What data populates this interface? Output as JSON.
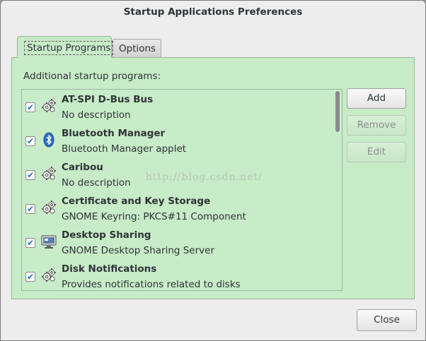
{
  "window": {
    "title": "Startup Applications Preferences"
  },
  "tabs": [
    {
      "label": "Startup Programs",
      "active": true
    },
    {
      "label": "Options",
      "active": false
    }
  ],
  "panel": {
    "label": "Additional startup programs:"
  },
  "programs": [
    {
      "name": "AT-SPI D-Bus Bus",
      "description": "No description",
      "checked": true,
      "icon": "gears-icon"
    },
    {
      "name": "Bluetooth Manager",
      "description": "Bluetooth Manager applet",
      "checked": true,
      "icon": "bluetooth-icon"
    },
    {
      "name": "Caribou",
      "description": "No description",
      "checked": true,
      "icon": "gears-icon"
    },
    {
      "name": "Certificate and Key Storage",
      "description": "GNOME Keyring: PKCS#11 Component",
      "checked": true,
      "icon": "gears-icon"
    },
    {
      "name": "Desktop Sharing",
      "description": "GNOME Desktop Sharing Server",
      "checked": true,
      "icon": "monitor-icon"
    },
    {
      "name": "Disk Notifications",
      "description": "Provides notifications related to disks",
      "checked": true,
      "icon": "gears-icon"
    }
  ],
  "buttons": {
    "add": "Add",
    "remove": "Remove",
    "edit": "Edit",
    "close": "Close"
  },
  "watermark": "http://blog.csdn.net/",
  "colors": {
    "panel_bg": "#c8ebc8",
    "check": "#2a6fc9",
    "bluetooth": "#2b6cc4"
  }
}
